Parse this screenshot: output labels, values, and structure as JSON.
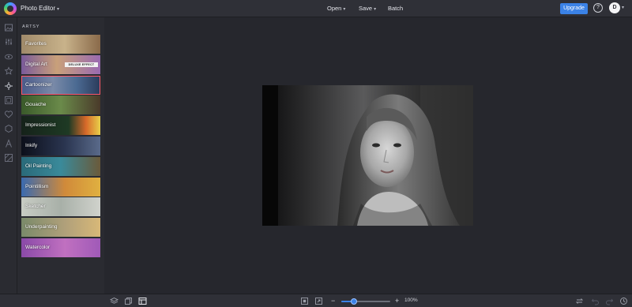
{
  "header": {
    "app_title": "Photo Editor",
    "menus": [
      "Open",
      "Save",
      "Batch"
    ],
    "upgrade_label": "Upgrade",
    "help_glyph": "?",
    "avatar_initial": "D",
    "colors": {
      "accent": "#3b82e6",
      "topbar": "#2f3037"
    }
  },
  "rail": {
    "icons": [
      "image-icon",
      "sliders-icon",
      "eye-icon",
      "star-icon",
      "paint-icon",
      "frame-icon",
      "heart-icon",
      "hexagon-icon",
      "text-icon",
      "texture-icon"
    ],
    "active_index": 4
  },
  "panel": {
    "section_label": "ARTSY",
    "tiles": [
      {
        "label": "Favorites",
        "bg": "linear-gradient(90deg,#a08a6a,#c8b28a 55%,#8a6a4a)"
      },
      {
        "label": "Digital Art",
        "badge": "DELUXE EFFECT",
        "bg": "linear-gradient(90deg,#7a5a9a,#c9a07a 45%,#9a6ab0)"
      },
      {
        "label": "Cartoonizer",
        "bg": "linear-gradient(90deg,#4a5a8a,#7a8aa8 40%,#4b6a92 70%,#2a3a5a)"
      },
      {
        "label": "Gouache",
        "bg": "linear-gradient(90deg,#3a5a2a,#6a8a4a 50%,#4a3a2a)"
      },
      {
        "label": "Impressionist",
        "bg": "linear-gradient(90deg,#15221a,#1e3a24 60%,#d86a2a 82%,#e8d04a)"
      },
      {
        "label": "Inkify",
        "bg": "linear-gradient(90deg,#0c0f1a,#2a3550 55%,#5a6a8a)"
      },
      {
        "label": "Oil Painting",
        "bg": "linear-gradient(90deg,#2a6a7a,#3a8a9a 50%,#6a5a3a)"
      },
      {
        "label": "Pointillism",
        "bg": "linear-gradient(90deg,#3a6ab0,#d08a3a 55%,#e0b040)"
      },
      {
        "label": "Sketcher",
        "bg": "linear-gradient(90deg,#c8ccc4,#a8b0a8 50%,#d0d2cc)"
      },
      {
        "label": "Underpainting",
        "bg": "linear-gradient(90deg,#7a8a6a,#b0a07a 55%,#d8b878)"
      },
      {
        "label": "Watercolor",
        "bg": "linear-gradient(90deg,#8a4aa8,#c070c0 55%,#a05ab8)"
      }
    ],
    "selected_index": 2
  },
  "canvas": {
    "background": "#26272d"
  },
  "bottombar": {
    "left_icons": [
      "layers-icon",
      "copy-icon",
      "layout-icon"
    ],
    "zoom_value": "100%",
    "zoom_fraction": 0.25,
    "right_icons": [
      "compare-icon",
      "undo-icon",
      "redo-icon",
      "history-icon"
    ]
  }
}
